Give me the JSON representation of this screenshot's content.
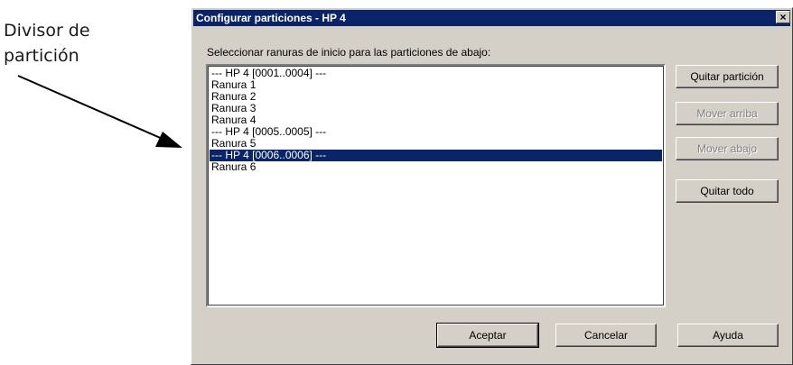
{
  "annotation": {
    "line1": "Divisor de",
    "line2": "partición"
  },
  "dialog": {
    "title": "Configurar particiones - HP 4",
    "close_symbol": "×",
    "prompt": "Seleccionar ranuras de inicio para las particiones de abajo:",
    "list_items": [
      "--- HP 4 [0001..0004] ---",
      "Ranura 1",
      "Ranura 2",
      "Ranura 3",
      "Ranura 4",
      "--- HP 4 [0005..0005] ---",
      "Ranura 5",
      "--- HP 4 [0006..0006] ---",
      "Ranura 6"
    ],
    "selected_item": "--- HP 4 [0006..0006] ---",
    "buttons": {
      "remove_partition": "Quitar partición",
      "move_up": "Mover arriba",
      "move_down": "Mover abajo",
      "remove_all": "Quitar todo",
      "accept": "Aceptar",
      "cancel": "Cancelar",
      "help": "Ayuda"
    }
  },
  "colors": {
    "title_bar": "#0a246a",
    "selection": "#0a246a",
    "dialog_face": "#d4d0c8"
  }
}
